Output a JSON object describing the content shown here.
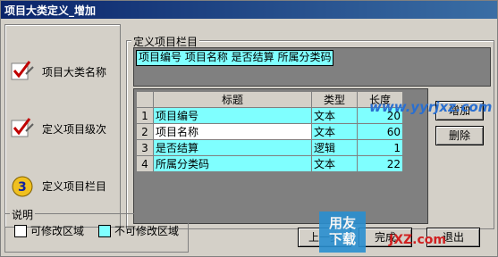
{
  "window": {
    "title": "项目大类定义_增加"
  },
  "steps": [
    {
      "label": "项目大类名称",
      "icon": "check-pencil-icon"
    },
    {
      "label": "定义项目级次",
      "icon": "check-pencil-icon"
    },
    {
      "label": "定义项目栏目",
      "icon": "step-3-icon"
    }
  ],
  "columns_group": {
    "label": "定义项目栏目",
    "chips_text": "项目编号  项目名称  是否结算  所属分类码"
  },
  "table": {
    "headers": [
      "标题",
      "类型",
      "长度"
    ],
    "rows": [
      {
        "n": "1",
        "title": "项目编号",
        "type": "文本",
        "len": "20"
      },
      {
        "n": "2",
        "title": "项目名称",
        "type": "文本",
        "len": "60"
      },
      {
        "n": "3",
        "title": "是否结算",
        "type": "逻辑",
        "len": "1"
      },
      {
        "n": "4",
        "title": "所属分类码",
        "type": "文本",
        "len": "22"
      }
    ]
  },
  "buttons": {
    "add": "增加",
    "delete": "删除",
    "prev": "上一步",
    "finish": "完成",
    "exit": "退出"
  },
  "legend": {
    "title": "说明",
    "editable": "可修改区域",
    "readonly": "不可修改区域"
  },
  "watermark": {
    "site": "www.yyrjxz.com",
    "logo": "用友下载",
    "corner": "JXZ.com"
  },
  "colors": {
    "readonly_cell": "#7fffff",
    "titlebar": "#0a246a"
  }
}
